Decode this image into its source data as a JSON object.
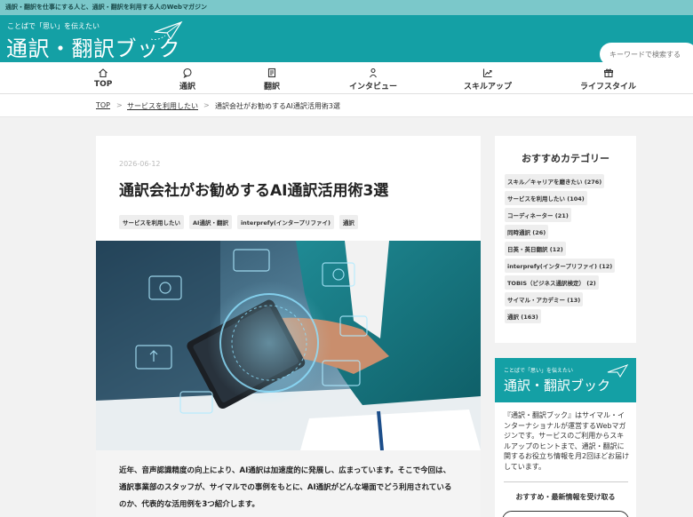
{
  "topbar": {
    "tagline": "通訳・翻訳を仕事にする人と、通訳・翻訳を利用する人のWebマガジン"
  },
  "header": {
    "logo_sub": "ことばで「思い」を伝えたい",
    "logo_main": "通訳・翻訳ブック",
    "search_placeholder": "キーワードで検索する"
  },
  "nav": {
    "items": [
      {
        "label": "TOP",
        "icon": "home-icon"
      },
      {
        "label": "通訳",
        "icon": "chat-icon"
      },
      {
        "label": "翻訳",
        "icon": "document-icon"
      },
      {
        "label": "インタビュー",
        "icon": "person-icon"
      },
      {
        "label": "スキルアップ",
        "icon": "chart-up-icon"
      },
      {
        "label": "ライフスタイル",
        "icon": "gift-icon"
      }
    ]
  },
  "breadcrumb": {
    "home": "TOP",
    "category": "サービスを利用したい",
    "current": "通訳会社がお勧めするAI通訳活用術3選",
    "separator": ">"
  },
  "article": {
    "date": "2026-06-12",
    "title": "通訳会社がお勧めするAI通訳活用術3選",
    "tags": [
      "サービスを利用したい",
      "AI通訳・翻訳",
      "interprefy(インタープリファイ)",
      "通訳"
    ],
    "intro": "近年、音声認識精度の向上により、AI通訳は加速度的に発展し、広まっています。そこで今回は、通訳事業部のスタッフが、サイマルでの事例をもとに、AI通訳がどんな場面でどう利用されているのか、代表的な活用例を3つ紹介します。"
  },
  "sidebar": {
    "title": "おすすめカテゴリー",
    "categories": [
      "スキル／キャリアを磨きたい (276)",
      "サービスを利用したい (104)",
      "コーディネーター (21)",
      "同時通訳 (26)",
      "日英・英日翻訳 (12)",
      "interprefy(インタープリファイ) (12)",
      "TOBIS（ビジネス通訳検定） (2)",
      "サイマル・アカデミー (13)",
      "通訳 (163)"
    ]
  },
  "about": {
    "logo_sub": "ことばで「思い」を伝えたい",
    "logo_main": "通訳・翻訳ブック",
    "text": "『通訳・翻訳ブック』はサイマル・インターナショナルが運営するWebマガジンです。サービスのご利用からスキルアップのヒントまで、通訳・翻訳に関するお役立ち情報を月2回ほどお届けしています。",
    "subscribe_label": "おすすめ・最新情報を受け取る"
  },
  "colors": {
    "brand": "#14a0a5",
    "topbar": "#7bc8ca"
  }
}
